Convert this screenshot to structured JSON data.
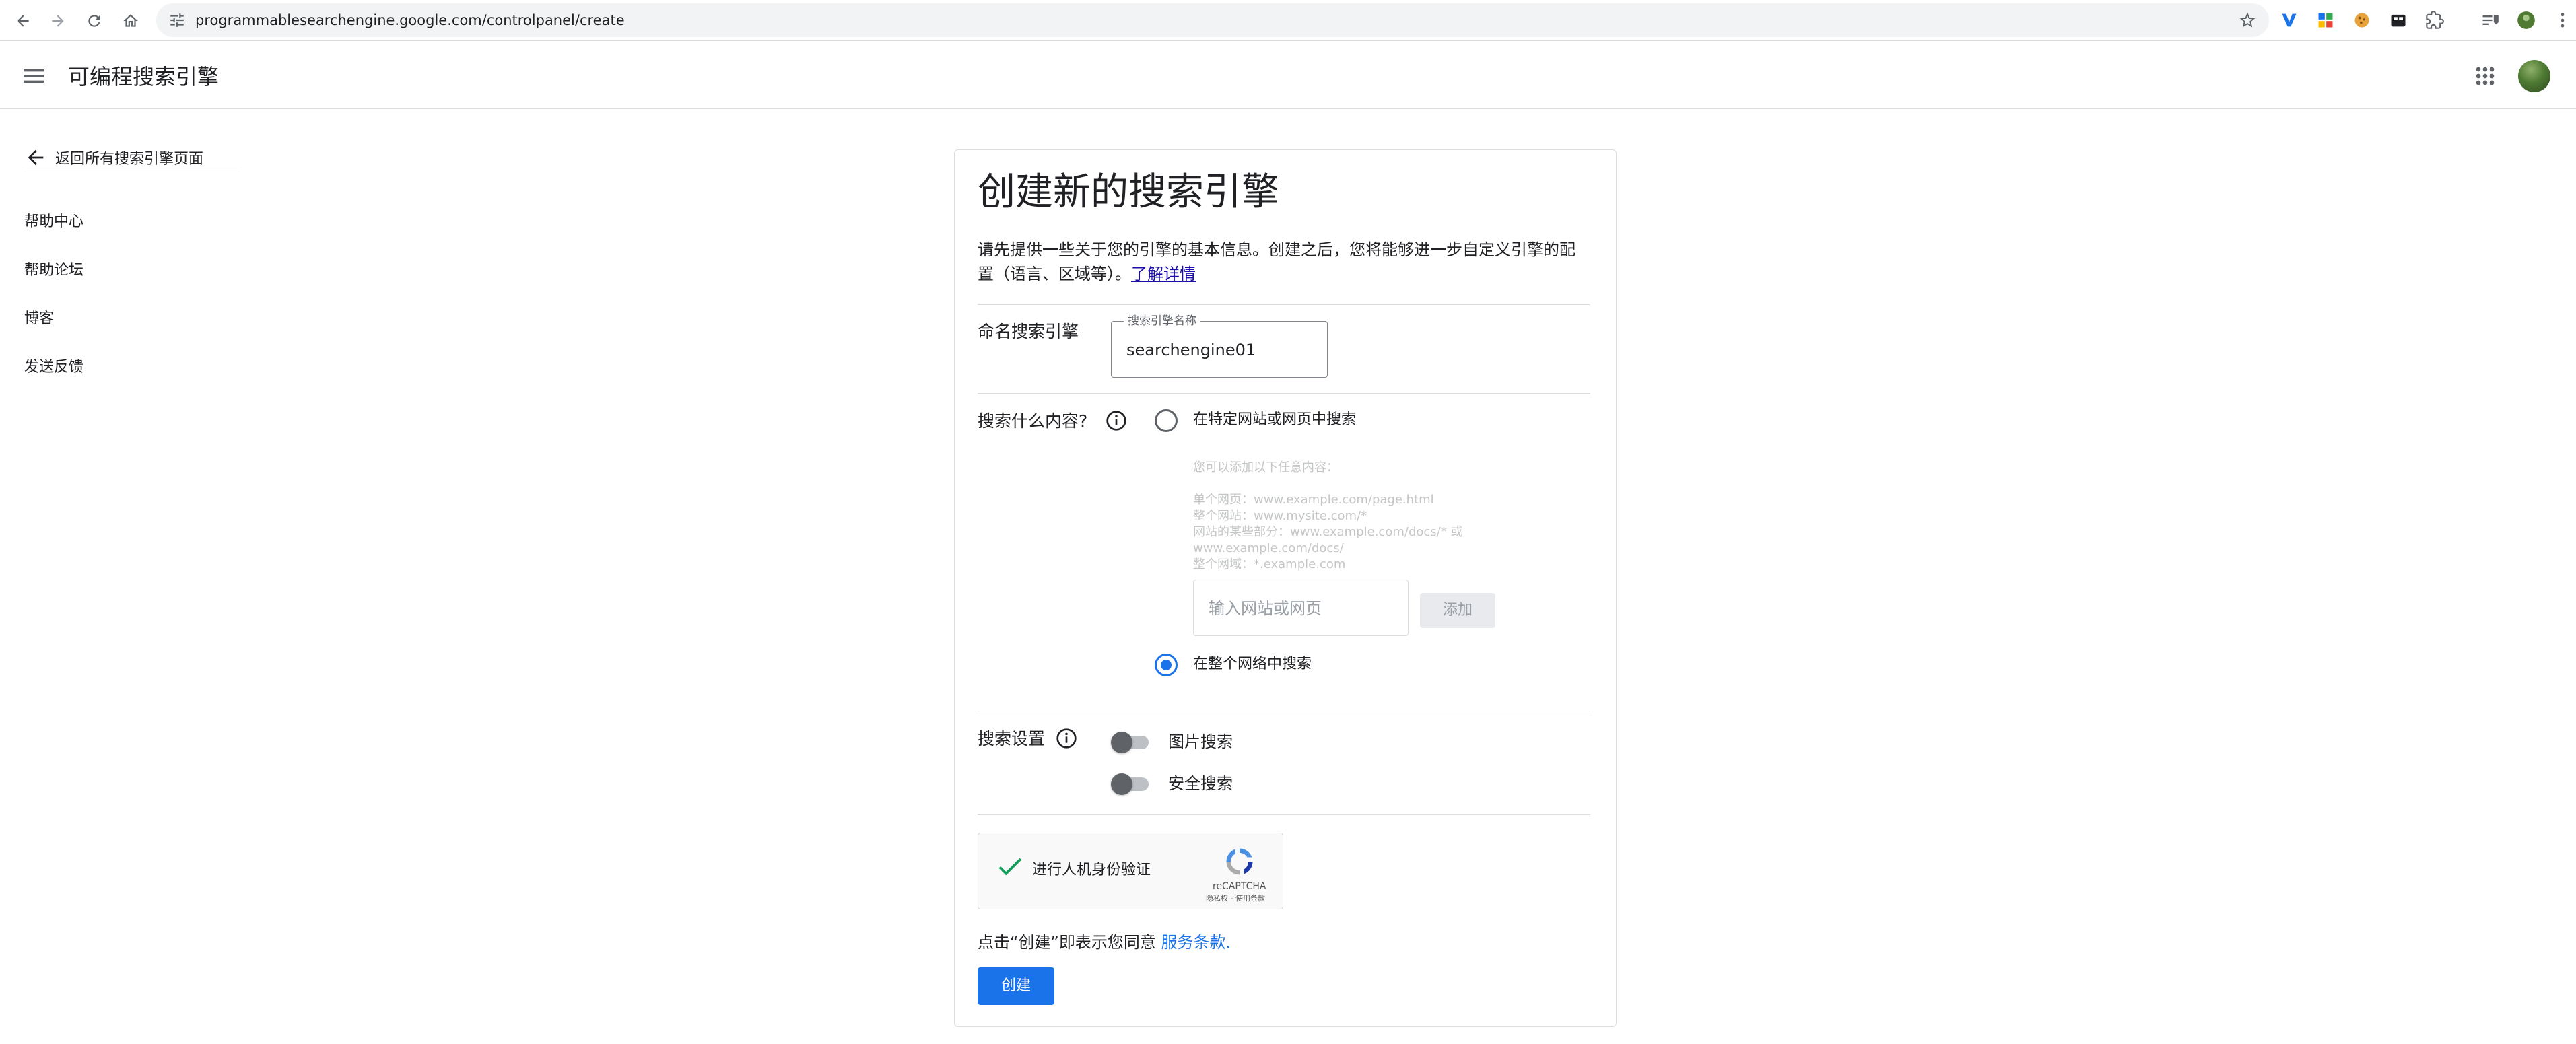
{
  "browser": {
    "url": "programmablesearchengine.google.com/controlpanel/create",
    "nav_icons": [
      "back-arrow-icon",
      "forward-arrow-icon",
      "reload-icon",
      "home-icon"
    ],
    "extension_icons": [
      "v-extension-icon",
      "grid-extension-icon",
      "cookie-extension-icon",
      "shop-extension-icon",
      "puzzle-extensions-icon",
      "reading-list-icon",
      "profile-avatar-icon",
      "kebab-menu-icon"
    ]
  },
  "header": {
    "title": "可编程搜索引擎"
  },
  "sidebar": {
    "back_label": "返回所有搜索引擎页面",
    "items": [
      {
        "label": "帮助中心"
      },
      {
        "label": "帮助论坛"
      },
      {
        "label": "博客"
      },
      {
        "label": "发送反馈"
      }
    ]
  },
  "form": {
    "title": "创建新的搜索引擎",
    "description": "请先提供一些关于您的引擎的基本信息。创建之后，您将能够进一步自定义引擎的配置（语言、区域等）。",
    "learn_more": "了解详情",
    "name_section": {
      "label": "命名搜索引擎",
      "field_label": "搜索引擎名称",
      "value": "searchengine01"
    },
    "what_section": {
      "label": "搜索什么内容?",
      "option_specific": "在特定网站或网页中搜索",
      "option_specific_checked": false,
      "hint_title": "您可以添加以下任意内容：",
      "hint_lines": [
        "单个网页：www.example.com/page.html",
        "整个网站：www.mysite.com/*",
        "网站的某些部分：www.example.com/docs/* 或 www.example.com/docs/",
        "整个网域：*.example.com"
      ],
      "site_placeholder": "输入网站或网页",
      "add_button": "添加",
      "option_web": "在整个网络中搜索",
      "option_web_checked": true
    },
    "settings_section": {
      "label": "搜索设置",
      "image_search": "图片搜索",
      "image_search_on": false,
      "safe_search": "安全搜索",
      "safe_search_on": false
    },
    "captcha": {
      "label": "进行人机身份验证",
      "brand": "reCAPTCHA",
      "terms": "隐私权 - 使用条款",
      "verified": true
    },
    "agree_text": "点击“创建”即表示您同意",
    "terms_link": "服务条款.",
    "create_button": "创建"
  },
  "colors": {
    "accent": "#1a73e8",
    "link": "#1a0dab",
    "divider": "#dadce0"
  }
}
